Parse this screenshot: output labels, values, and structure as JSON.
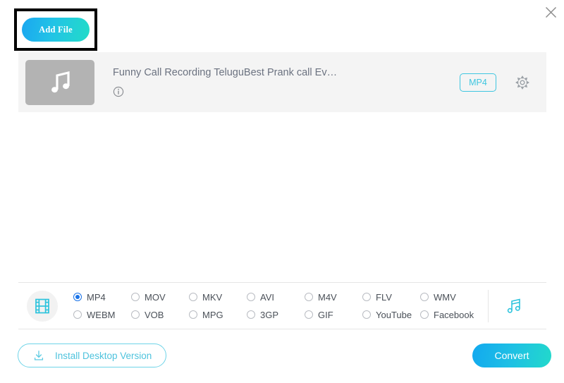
{
  "window": {
    "close_label": "×"
  },
  "toolbar": {
    "add_file_label": "Add File"
  },
  "file_row": {
    "thumbnail_icon": "music-note-icon",
    "file_name": "Funny Call Recording TeluguBest Prank call Ev…",
    "info_icon": "info-icon",
    "format_badge": "MP4",
    "settings_icon": "gear-icon"
  },
  "format_selector": {
    "type_icon": "film-strip-icon",
    "audio_tab_icon": "music-note-icon",
    "options": [
      {
        "label": "MP4",
        "checked": true
      },
      {
        "label": "MOV",
        "checked": false
      },
      {
        "label": "MKV",
        "checked": false
      },
      {
        "label": "AVI",
        "checked": false
      },
      {
        "label": "M4V",
        "checked": false
      },
      {
        "label": "FLV",
        "checked": false
      },
      {
        "label": "WMV",
        "checked": false
      },
      {
        "label": "WEBM",
        "checked": false
      },
      {
        "label": "VOB",
        "checked": false
      },
      {
        "label": "MPG",
        "checked": false
      },
      {
        "label": "3GP",
        "checked": false
      },
      {
        "label": "GIF",
        "checked": false
      },
      {
        "label": "YouTube",
        "checked": false
      },
      {
        "label": "Facebook",
        "checked": false
      }
    ]
  },
  "footer": {
    "install_label": "Install Desktop Version",
    "install_icon": "download-icon",
    "convert_label": "Convert"
  },
  "colors": {
    "accent_cyan": "#3ec6e0",
    "radio_selected": "#1a73e8",
    "row_background": "#f4f4f4",
    "thumbnail_gray": "#b3b3b3"
  }
}
